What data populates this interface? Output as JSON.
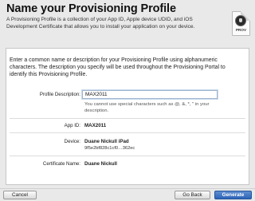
{
  "dialog": {
    "title": "Name your Provisioning Profile",
    "intro": "A Provisioning Profile is a collection of your App ID, Apple device UDID, and iOS Development Certificate that allows you to install your application on your device.",
    "icon_label": "PROV",
    "instructions": "Enter a common name or description for your Provisioning Profile using alphanumeric characters. The description you specify will be used throughout the Provisioning Portal to identify this Provisioning Profile."
  },
  "form": {
    "profile_description_label": "Profile Description:",
    "profile_description_value": "MAX2011",
    "hint": "You cannot use special characters such as @, &, *, \" in your description.",
    "app_id_label": "App ID:",
    "app_id_value": "MAX2011",
    "device_label": "Device:",
    "device_name": "Duane Nickull iPad",
    "device_identifier": "9f5e2bf828c1cf0…362ec",
    "certificate_label": "Certificate Name:",
    "certificate_value": "Duane Nickull"
  },
  "footer": {
    "cancel_label": "Cancel",
    "back_label": "Go Back",
    "generate_label": "Generate"
  }
}
